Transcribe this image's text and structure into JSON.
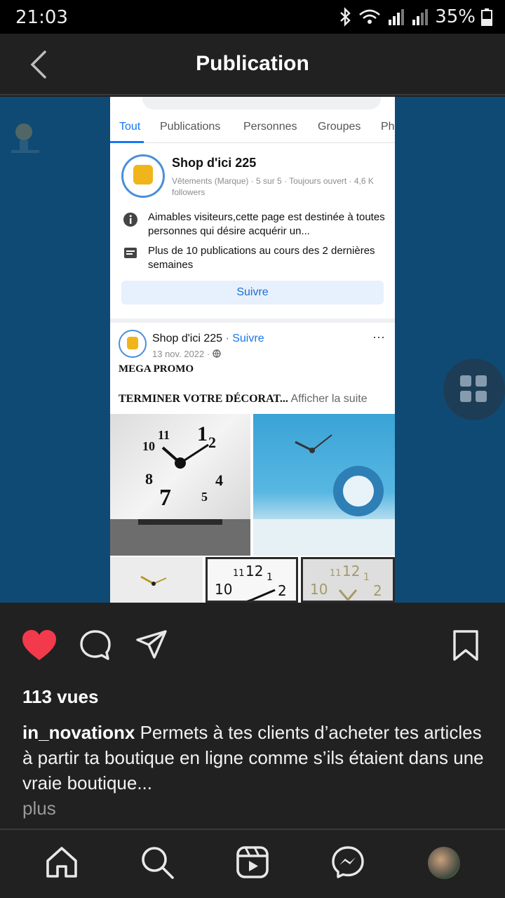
{
  "status_bar": {
    "time": "21:03",
    "battery": "35%",
    "icons": [
      "bluetooth-icon",
      "wifi-icon",
      "signal-icon",
      "signal-icon",
      "battery-icon"
    ]
  },
  "header": {
    "title": "Publication",
    "back_icon": "chevron-left-icon"
  },
  "media": {
    "fb_tabs": [
      "Tout",
      "Publications",
      "Personnes",
      "Groupes",
      "Ph"
    ],
    "page_card": {
      "name": "Shop d'ici 225",
      "meta": "Vêtements (Marque) · 5 sur 5 · Toujours ouvert · 4,6 K followers",
      "info_1": "Aimables visiteurs,cette page est destinée à toutes personnes qui désire acquérir un...",
      "info_2": "Plus de 10 publications au cours des 2 dernières semaines",
      "follow_label": "Suivre"
    },
    "post": {
      "author": "Shop d'ici 225",
      "follow": " · Suivre",
      "date": "13 nov. 2022 · ",
      "more": "···",
      "line1": "MEGA PROMO",
      "line2": "TERMINER VOTRE DÉCORAT...",
      "see_more": " Afficher la suite"
    }
  },
  "actions": {
    "like_icon": "heart-icon",
    "comment_icon": "comment-icon",
    "share_icon": "send-icon",
    "save_icon": "bookmark-icon",
    "liked": true,
    "accent": "#f23a4c"
  },
  "post_info": {
    "views": "113 vues",
    "username": "in_novationx",
    "caption": " Permets à tes clients d’acheter tes articles à partir ta boutique en ligne comme s’ils étaient dans une vraie boutique...",
    "more": "plus"
  },
  "bottom_nav": {
    "items": [
      "home-icon",
      "search-icon",
      "reels-icon",
      "messenger-icon",
      "profile-avatar"
    ]
  }
}
